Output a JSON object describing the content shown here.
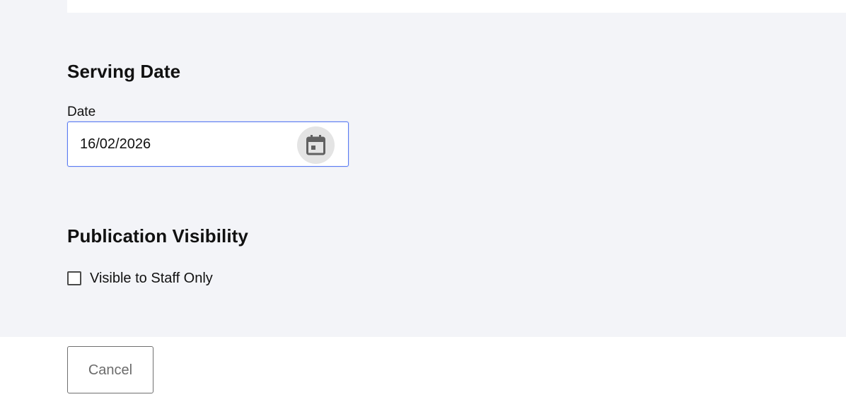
{
  "serving_date": {
    "title": "Serving Date",
    "field_label": "Date",
    "value": "16/02/2026",
    "calendar_icon": "calendar-icon"
  },
  "publication_visibility": {
    "title": "Publication Visibility",
    "checkbox_label": "Visible to Staff Only",
    "checked": false
  },
  "footer": {
    "cancel_label": "Cancel"
  },
  "colors": {
    "form_background": "#f3f4f8",
    "input_focus_border": "#5b7cf2",
    "icon_button_background": "#e4e4e4",
    "cancel_text": "#6b6b6b"
  }
}
